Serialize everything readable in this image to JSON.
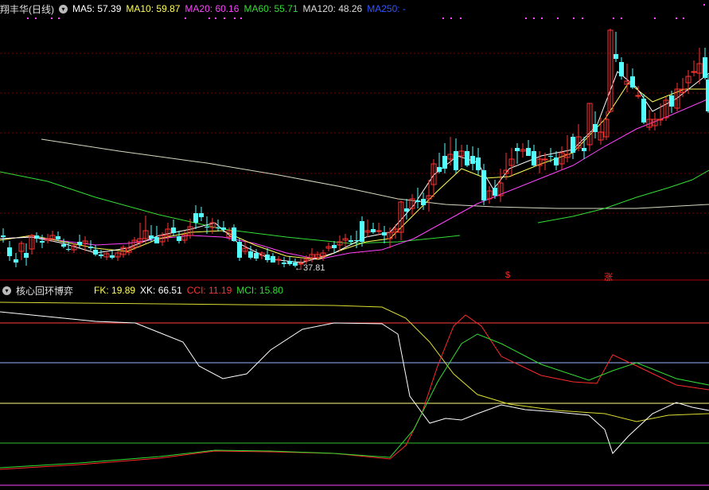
{
  "main": {
    "title": "翔丰华(日线)",
    "indicators": [
      {
        "label": "MA5: 57.39",
        "color": "#ffffff"
      },
      {
        "label": "MA10: 59.87",
        "color": "#ffff55"
      },
      {
        "label": "MA20: 60.16",
        "color": "#ff44ff"
      },
      {
        "label": "MA60: 55.71",
        "color": "#33dd33"
      },
      {
        "label": "MA120: 48.26",
        "color": "#dddddd"
      },
      {
        "label": "MA250: -",
        "color": "#3355ff"
      }
    ],
    "low_label": "←37.81",
    "marker_s": "$",
    "marker_zhang": "涨"
  },
  "sub": {
    "title": "核心回环博弈",
    "indicators": [
      {
        "label": "FK: 19.89",
        "color": "#ffff55"
      },
      {
        "label": "XK: 66.51",
        "color": "#ffffff"
      },
      {
        "label": "CCI: 11.19",
        "color": "#ff3333"
      },
      {
        "label": "MCI: 15.80",
        "color": "#33dd33"
      }
    ]
  },
  "colors": {
    "up": "#ff3232",
    "down": "#54ffff",
    "grid": "#7a0000",
    "divider": "#b00000"
  }
}
